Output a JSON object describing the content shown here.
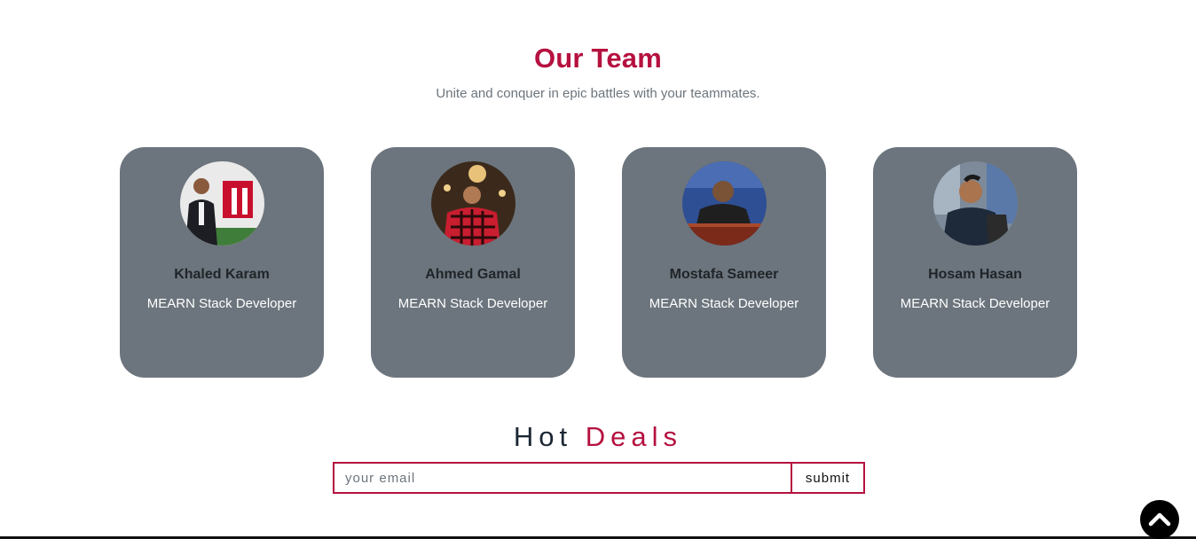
{
  "team": {
    "title": "Our Team",
    "subtitle": "Unite and conquer in epic battles with your teammates.",
    "members": [
      {
        "name": "Khaled Karam",
        "role": "MEARN Stack Developer"
      },
      {
        "name": "Ahmed Gamal",
        "role": "MEARN Stack Developer"
      },
      {
        "name": "Mostafa Sameer",
        "role": "MEARN Stack Developer"
      },
      {
        "name": "Hosam Hasan",
        "role": "MEARN Stack Developer"
      }
    ]
  },
  "deals": {
    "title_word1": "Hot",
    "title_word2": "Deals",
    "email_placeholder": "your email",
    "submit_label": "submit"
  },
  "icons": {
    "scroll_top": "chevron-up-icon"
  },
  "colors": {
    "accent": "#b5113f",
    "card_bg": "#6c757d",
    "subtitle_text": "#6c757d"
  }
}
